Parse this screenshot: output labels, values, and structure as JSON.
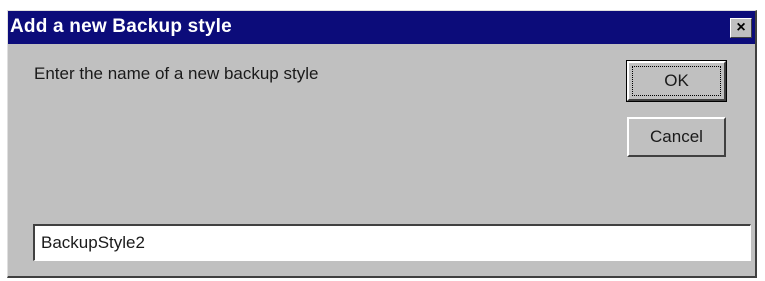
{
  "window": {
    "title": "Add a new Backup style",
    "close_label": "×"
  },
  "prompt": {
    "text": "Enter the name of a new backup style"
  },
  "buttons": {
    "ok_label": "OK",
    "cancel_label": "Cancel"
  },
  "name_input": {
    "value": "BackupStyle2"
  },
  "colors": {
    "titlebar": "#0c0c7a",
    "dialog_face": "#c0c0c0",
    "input_background": "#ffffff"
  },
  "icons": {
    "close": "close-icon"
  }
}
